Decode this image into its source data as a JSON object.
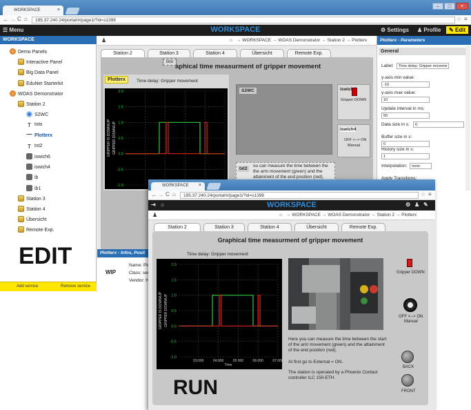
{
  "edit": {
    "browser_tab": "WORKSPACE",
    "url": "195.37.240.24/portal/#/page1/?id=s1399",
    "app_title": "WORKSPACE",
    "menu_label": "Menu",
    "settings_label": "Settings",
    "profile_label": "Profile",
    "edit_label": "Edit",
    "sidebar_header": "WORKSPACE",
    "breadcrumb": "→ WORKSPACE → WOAS Demonstrator → Station 2 → Plotterx",
    "tree": [
      {
        "label": "Demo Panels",
        "icon": "demo"
      },
      {
        "label": "Interactive Panel",
        "icon": "folder"
      },
      {
        "label": "Big Data Panel",
        "icon": "folder"
      },
      {
        "label": "EduNet Starterkit",
        "icon": "folder"
      },
      {
        "label": "WOAS Demonstrator",
        "icon": "demo"
      },
      {
        "label": "Station 2",
        "icon": "folder"
      },
      {
        "label": "S2WC",
        "icon": "service"
      },
      {
        "label": "txto",
        "icon": "text"
      },
      {
        "label": "Plotterx",
        "icon": "plot"
      },
      {
        "label": "txt2",
        "icon": "text"
      },
      {
        "label": "iswich6",
        "icon": "switch"
      },
      {
        "label": "iswich4",
        "icon": "switch"
      },
      {
        "label": "ib",
        "icon": "switch"
      },
      {
        "label": "ib1",
        "icon": "switch"
      },
      {
        "label": "Station 3",
        "icon": "folder"
      },
      {
        "label": "Station 4",
        "icon": "folder"
      },
      {
        "label": "Übersicht",
        "icon": "folder"
      },
      {
        "label": "Remote Exp.",
        "icon": "folder"
      }
    ],
    "add_service": "Add service",
    "remove_service": "Remove service",
    "mode_label": "EDIT",
    "tabs": [
      "Station 2",
      "Station 3",
      "Station 4",
      "Übersicht",
      "Remote Exp."
    ],
    "canvas_title": "aphical time measurment of gripper movement",
    "txto_tag": "txto",
    "plotter_tag": "Plotterx",
    "time_delay": "Time delay: Gripper movement",
    "s2wc_tag": "S2WC",
    "txt2_tag": "txt2",
    "txt2_text": "ou can measure the time between the the arm movement (green) and the attainment of the end position (red).",
    "iswich6_tag": "iswich6",
    "gripper_down": "Gripper DOWN",
    "iswich4_tag": "iswich4",
    "off_on": "OFF <--> ON",
    "manual": "Manual",
    "info_header": "Plotterx - Infos, Posit",
    "wip": "WIP",
    "info_name": "Name: Plo",
    "info_class": "Class: ser",
    "info_vendor": "Vendor: H",
    "params_header": "Plotterx - Parameters",
    "general": "General",
    "params": [
      {
        "label": "Label:",
        "value": "Time delay: Gripper moveme"
      },
      {
        "label": "y-axis min value:",
        "value": "-10"
      },
      {
        "label": "y-axis max value:",
        "value": "10"
      },
      {
        "label": "Update interval in ms:",
        "value": "50"
      },
      {
        "label": "Data size in s:",
        "value": "6"
      },
      {
        "label": "Buffer size in s:",
        "value": "0"
      },
      {
        "label": "History size in s:",
        "value": "1"
      },
      {
        "label": "Interpolation:",
        "value": "none"
      },
      {
        "label": "Apply Transitions:",
        "value": ""
      }
    ]
  },
  "run": {
    "browser_tab": "WORKSPACE",
    "url": "195.37.240.24/portal/#/page1/?id=s1399",
    "app_title": "WORKSPACE",
    "breadcrumb": "→ WORKSPACE → WOAS Demonstrator → Station 2 → Plotterx",
    "tabs": [
      "Station 2",
      "Station 3",
      "Station 4",
      "Übersicht",
      "Remote Exp."
    ],
    "heading": "Graphical time measurment of gripper movement",
    "time_delay": "Time delay: Gripper movement",
    "gripper_down": "Gripper DOWN",
    "off_on": "OFF <--> ON",
    "manual": "Manual",
    "back": "BACK",
    "front": "FRONT",
    "desc1": "Here you can measure the time between the start of the arm movement (green) and the attainment of the end position (red).",
    "desc2": "At first go to External = ON.",
    "desc3": "The station is operated by a Phoenix Contact controller ILC 150-ETH.",
    "mode_label": "RUN"
  },
  "chart_data": {
    "type": "line",
    "title": "Time delay: Gripper movement",
    "xlabel": "Time",
    "ylabel": "GRIPPER IS DOWN/UP",
    "ylabel2": "GRIPPER DOWN/UP",
    "x_ticks": [
      "03:000",
      "04:000",
      "05:000",
      "06:000",
      "07:000"
    ],
    "y_ticks": [
      "2.0",
      "1.5",
      "1.0",
      "0.5",
      "0.0",
      "-0.5",
      "-1.0"
    ],
    "ylim": [
      -1.0,
      2.0
    ],
    "xlim": [
      2.0,
      7.0
    ],
    "series": [
      {
        "color": "#2ecc40",
        "points": [
          [
            2.0,
            0
          ],
          [
            3.7,
            0
          ],
          [
            3.7,
            1
          ],
          [
            5.75,
            1
          ],
          [
            5.75,
            0
          ],
          [
            7.0,
            0
          ]
        ]
      },
      {
        "color": "#e0201a",
        "points": [
          [
            2.0,
            0
          ],
          [
            4.05,
            0
          ],
          [
            4.05,
            1
          ],
          [
            4.15,
            1
          ],
          [
            4.15,
            0
          ],
          [
            6.0,
            0
          ],
          [
            6.0,
            1
          ],
          [
            6.1,
            1
          ],
          [
            6.1,
            0
          ],
          [
            7.0,
            0
          ]
        ]
      }
    ],
    "grid": true
  }
}
